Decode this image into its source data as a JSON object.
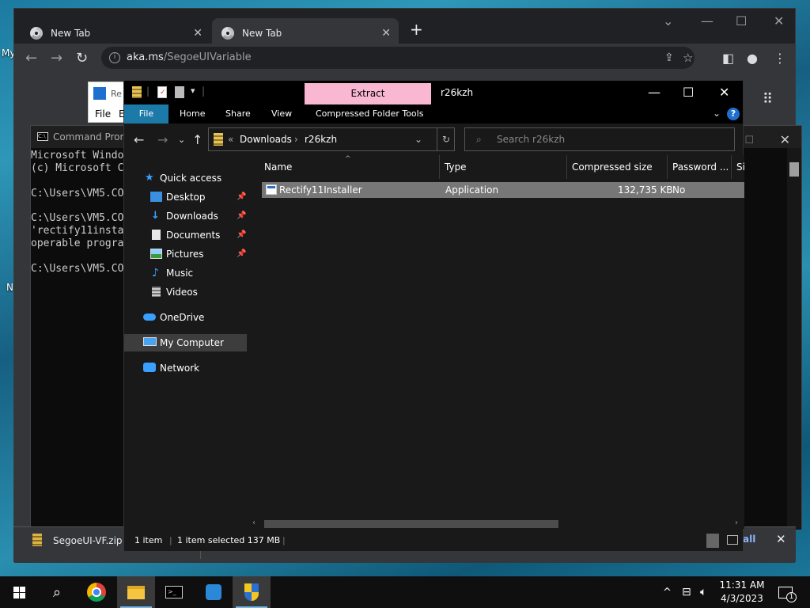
{
  "desktop": {
    "fragment_my": "My",
    "fragment_n": "N"
  },
  "chrome": {
    "tabs": [
      {
        "title": "New Tab"
      },
      {
        "title": "New Tab"
      }
    ],
    "new_tab_symbol": "+",
    "url_host": "aka.ms",
    "url_path": "/SegoeUIVariable",
    "download_item": "SegoeUI-VF.zip",
    "download_show_all": "all"
  },
  "background_explorer": {
    "file_fragment": "File",
    "e_fragment": "E",
    "re_fragment": "Re"
  },
  "cmd": {
    "title": "Command Prom",
    "lines": [
      "Microsoft Windo",
      "(c) Microsoft C",
      "",
      "C:\\Users\\VM5.CO",
      "",
      "C:\\Users\\VM5.CO",
      "'rectify11insta",
      "operable progra",
      "",
      "C:\\Users\\VM5.CO"
    ]
  },
  "explorer": {
    "title": "r26kzh",
    "contextual_tab": "Extract",
    "ribbon_tabs": [
      "File",
      "Home",
      "Share",
      "View",
      "Compressed Folder Tools"
    ],
    "breadcrumb": {
      "chevron": "«",
      "items": [
        "Downloads",
        "r26kzh"
      ],
      "separator": "›"
    },
    "search_placeholder": "Search r26kzh",
    "nav": {
      "quick_access": "Quick access",
      "desktop": "Desktop",
      "downloads": "Downloads",
      "documents": "Documents",
      "pictures": "Pictures",
      "music": "Music",
      "videos": "Videos",
      "onedrive": "OneDrive",
      "my_computer": "My Computer",
      "network": "Network"
    },
    "columns": {
      "name": "Name",
      "type": "Type",
      "compressed_size": "Compressed size",
      "password": "Password ...",
      "size": "Si"
    },
    "files": [
      {
        "name": "Rectify11Installer",
        "type": "Application",
        "compressed_size": "132,735 KB",
        "password": "No"
      }
    ],
    "status": {
      "count": "1 item",
      "selected": "1 item selected  137 MB"
    }
  },
  "taskbar": {
    "time": "11:31 AM",
    "date": "4/3/2023",
    "notification_count": "1"
  },
  "colors": {
    "extract_tab_bg": "#f9b7d2",
    "file_tab_bg": "#1c7aa8",
    "selection_row": "#777777",
    "taskbar_accent": "#76b9ed"
  }
}
